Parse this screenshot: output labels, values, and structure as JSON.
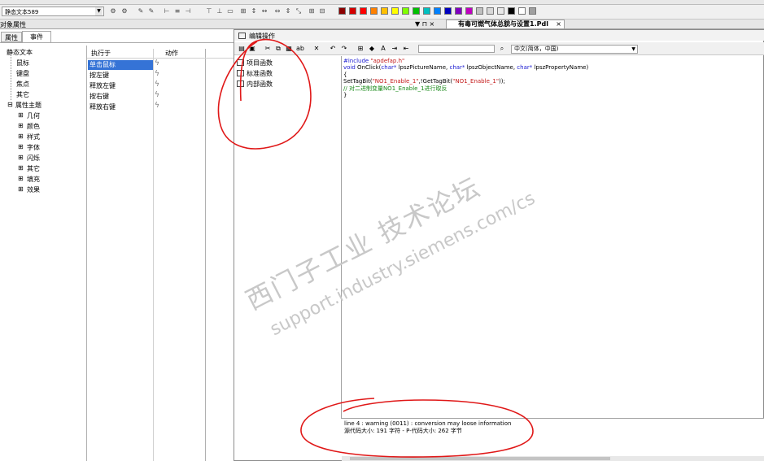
{
  "toolbar": {
    "object_combo": "静态文本589",
    "colors": [
      "#8b0000",
      "#d40000",
      "#ff0000",
      "#ff8000",
      "#ffc000",
      "#ffff00",
      "#80ff00",
      "#00c000",
      "#00c0c0",
      "#0080ff",
      "#0000c0",
      "#8000c0",
      "#c000c0",
      "#c0c0c0",
      "#d8d8d8",
      "#e8e8e8",
      "#000000",
      "#ffffff",
      "#a0a0a0"
    ]
  },
  "doc_tab": {
    "title": "有毒可燃气体总貌与设置1.Pdl",
    "close": "×",
    "controls": "▼ ⊓ ×"
  },
  "object_properties": {
    "title": "对象属性",
    "tabs": [
      "属性",
      "事件"
    ],
    "tree": {
      "root": "静态文本",
      "items": [
        "鼠标",
        "键盘",
        "焦点",
        "其它"
      ],
      "topic": "属性主题",
      "topic_children": [
        "几何",
        "颜色",
        "样式",
        "字体",
        "闪烁",
        "其它",
        "填充",
        "效果"
      ]
    },
    "events_header": {
      "executed_on": "执行于",
      "action": "动作"
    },
    "events": [
      "单击鼠标",
      "按左键",
      "释放左键",
      "按右键",
      "释放右键"
    ]
  },
  "editor": {
    "title": "编辑操作",
    "language": "中文(简体，中国)",
    "function_tree": [
      "项目函数",
      "标准函数",
      "内部函数"
    ],
    "code": {
      "include_kw": "#include",
      "include_str": " \"apdefap.h\"",
      "sig_void": "void",
      "sig_name": " OnClick(",
      "sig_char1": "char*",
      "sig_p1": " lpszPictureName, ",
      "sig_char2": "char*",
      "sig_p2": " lpszObjectName, ",
      "sig_char3": "char*",
      "sig_p3": " lpszPropertyName)",
      "brace_open": "{",
      "stmt_a": "SetTagBit(",
      "stmt_s1": "\"NO1_Enable_1\"",
      "stmt_b": ",!GetTagBit(",
      "stmt_s2": "\"NO1_Enable_1\"",
      "stmt_c": "));",
      "comment": "// 对二进制变量NO1_Enable_1进行取反",
      "brace_close": "}"
    },
    "output": {
      "line1": "line 4 : warning (0011) : conversion may loose information",
      "line2": "源代码大小: 191 字符 - P-代码大小: 262 字节"
    }
  },
  "watermark": {
    "line1": "西门子工业 技术论坛",
    "line2": "support.industry.siemens.com/cs"
  }
}
